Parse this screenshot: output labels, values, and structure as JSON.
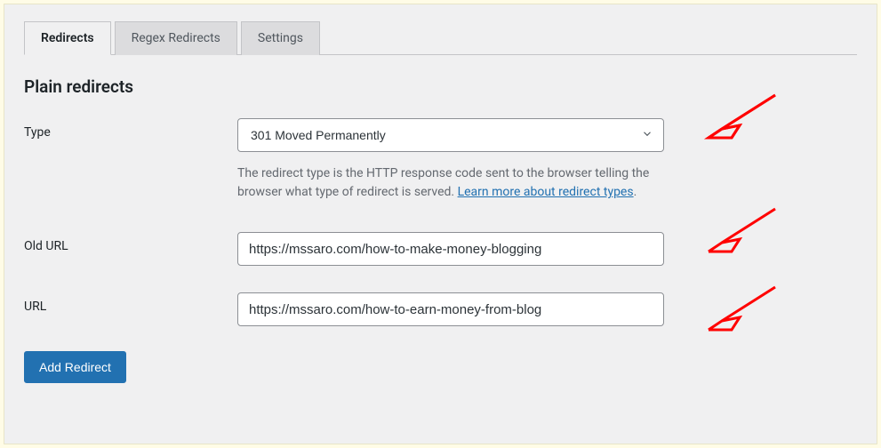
{
  "tabs": {
    "redirects": "Redirects",
    "regex": "Regex Redirects",
    "settings": "Settings"
  },
  "section": {
    "title": "Plain redirects"
  },
  "form": {
    "type_label": "Type",
    "type_value": "301 Moved Permanently",
    "help_text_prefix": "The redirect type is the HTTP response code sent to the browser telling the browser what type of redirect is served. ",
    "help_link_text": "Learn more about redirect types",
    "old_url_label": "Old URL",
    "old_url_value": "https://mssaro.com/how-to-make-money-blogging",
    "url_label": "URL",
    "url_value": "https://mssaro.com/how-to-earn-money-from-blog"
  },
  "buttons": {
    "add_redirect": "Add Redirect"
  },
  "annotations": {
    "arrow_color": "#ff0000"
  }
}
